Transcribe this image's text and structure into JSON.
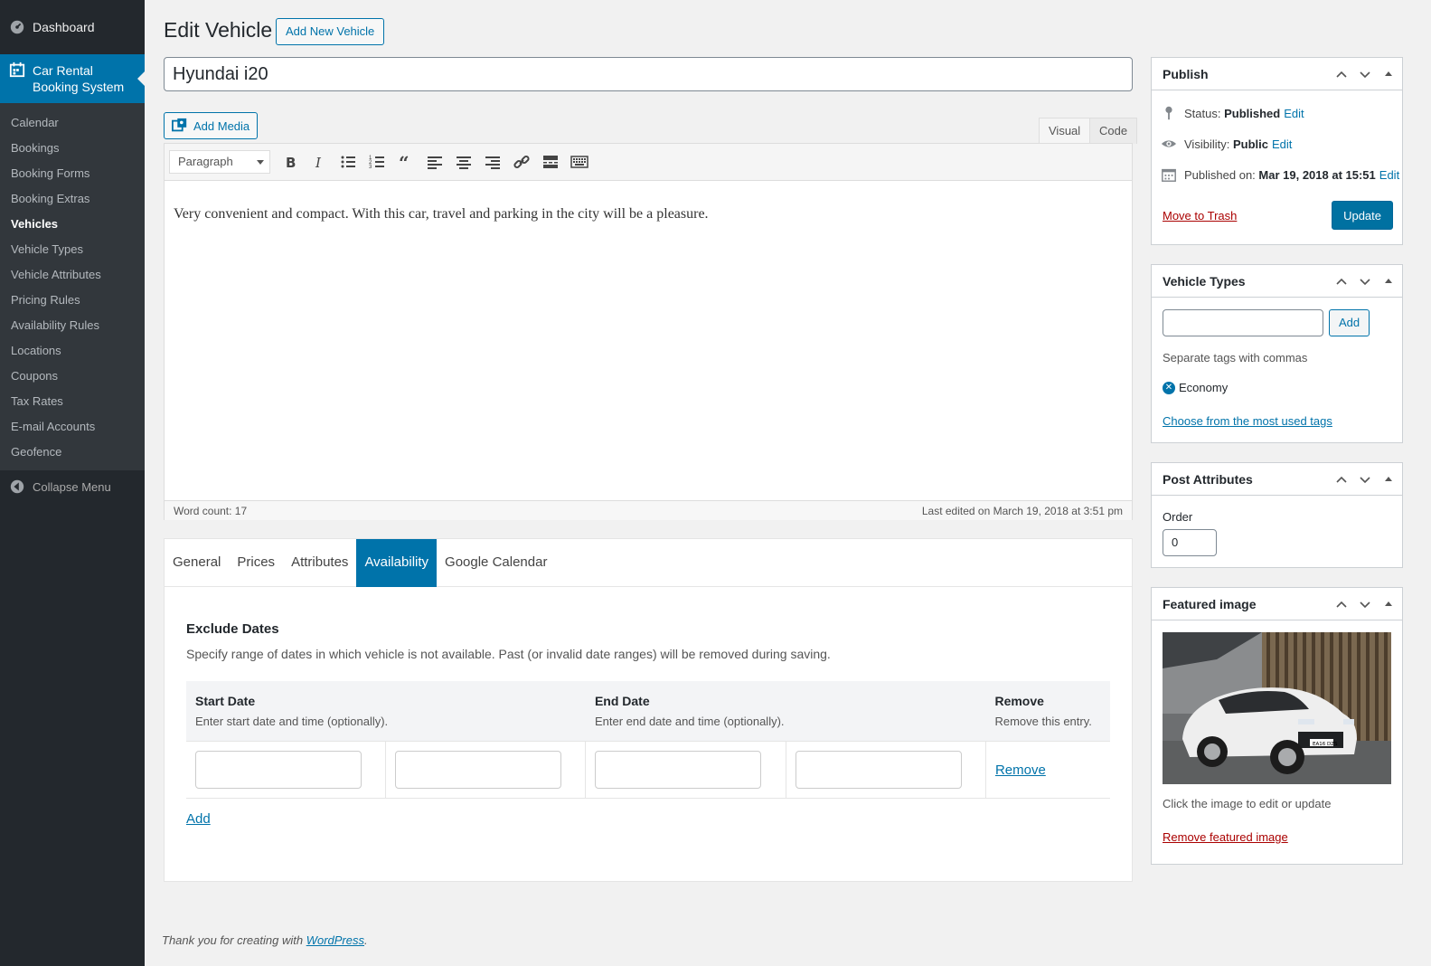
{
  "sidebar": {
    "dashboard_label": "Dashboard",
    "current_menu_label": "Car Rental Booking System",
    "items": [
      {
        "label": "Calendar"
      },
      {
        "label": "Bookings"
      },
      {
        "label": "Booking Forms"
      },
      {
        "label": "Booking Extras"
      },
      {
        "label": "Vehicles",
        "active": true
      },
      {
        "label": "Vehicle Types"
      },
      {
        "label": "Vehicle Attributes"
      },
      {
        "label": "Pricing Rules"
      },
      {
        "label": "Availability Rules"
      },
      {
        "label": "Locations"
      },
      {
        "label": "Coupons"
      },
      {
        "label": "Tax Rates"
      },
      {
        "label": "E-mail Accounts"
      },
      {
        "label": "Geofence"
      }
    ],
    "collapse_label": "Collapse Menu"
  },
  "header": {
    "title": "Edit Vehicle",
    "add_new_label": "Add New Vehicle"
  },
  "post": {
    "title_value": "Hyundai i20",
    "add_media_label": "Add Media",
    "tab_visual": "Visual",
    "tab_code": "Code",
    "format_select": "Paragraph",
    "content": "Very convenient and compact. With this car, travel and parking in the city will be a pleasure.",
    "word_count": "Word count: 17",
    "last_edited": "Last edited on March 19, 2018 at 3:51 pm"
  },
  "vehicle_tabs": {
    "tabs": [
      "General",
      "Prices",
      "Attributes",
      "Availability",
      "Google Calendar"
    ],
    "active": "Availability",
    "heading": "Exclude Dates",
    "description": "Specify range of dates in which vehicle is not available. Past (or invalid date ranges) will be removed during saving.",
    "columns": [
      {
        "title": "Start Date",
        "sub": "Enter start date and time (optionally)."
      },
      {
        "title": "End Date",
        "sub": "Enter end date and time (optionally)."
      },
      {
        "title": "Remove",
        "sub": "Remove this entry."
      }
    ],
    "remove_label": "Remove",
    "add_label": "Add"
  },
  "publish": {
    "title": "Publish",
    "status_label": "Status:",
    "status_value": "Published",
    "visibility_label": "Visibility:",
    "visibility_value": "Public",
    "published_label": "Published on:",
    "published_value": "Mar 19, 2018 at 15:51",
    "edit_label": "Edit",
    "trash_label": "Move to Trash",
    "update_label": "Update"
  },
  "vehicle_types": {
    "title": "Vehicle Types",
    "add_label": "Add",
    "hint": "Separate tags with commas",
    "tags": [
      "Economy"
    ],
    "choose_label": "Choose from the most used tags"
  },
  "post_attributes": {
    "title": "Post Attributes",
    "order_label": "Order",
    "order_value": "0"
  },
  "featured_image": {
    "title": "Featured image",
    "hint": "Click the image to edit or update",
    "remove_label": "Remove featured image",
    "plate_text": "EA16 DZS"
  },
  "footer": {
    "text": "Thank you for creating with ",
    "link": "WordPress",
    "suffix": "."
  },
  "colors": {
    "accent": "#0073aa",
    "sidebar_bg": "#23282d",
    "submenu_bg": "#32373c",
    "danger": "#aa0000"
  }
}
